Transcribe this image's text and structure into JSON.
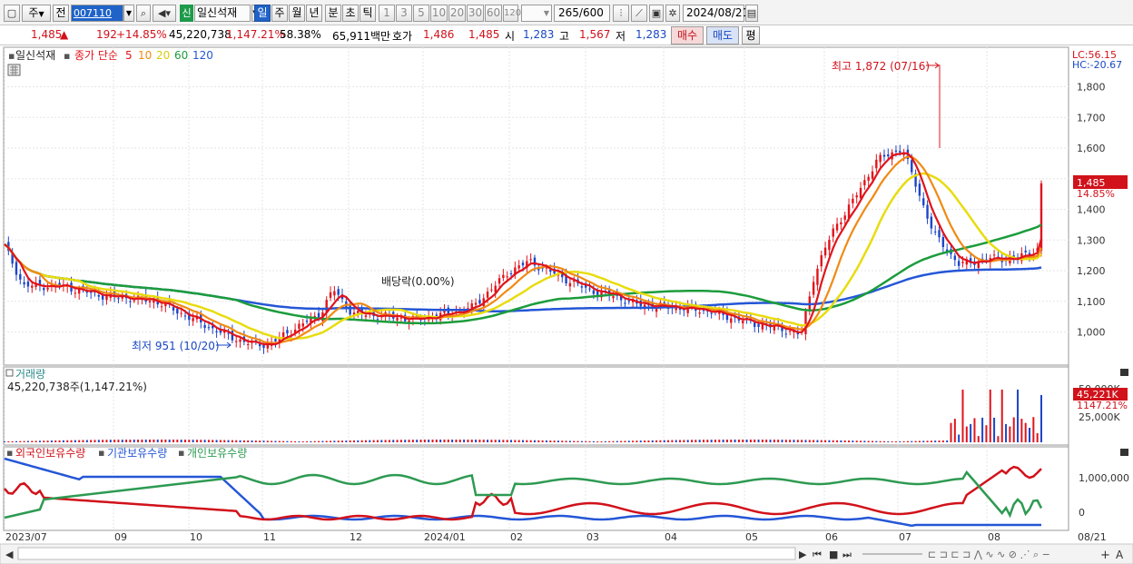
{
  "toolbar": {
    "unit_select": "주",
    "prev_label": "전",
    "stock_code": "007110",
    "badge": "신",
    "stock_name": "일신석재",
    "periods": [
      "일",
      "주",
      "월",
      "년",
      "분",
      "초",
      "틱"
    ],
    "selected_period": "일",
    "intervals": [
      "1",
      "3",
      "5",
      "10",
      "20",
      "30",
      "60",
      "120"
    ],
    "count_display": "265",
    "count_total": "/600",
    "date": "2024/08/21"
  },
  "info": {
    "price": "1,485",
    "change": "192",
    "change_pct": "+14.85%",
    "volume": "45,220,738",
    "volume_ratio": "1,147.21%",
    "turnover_pct": "58.38%",
    "trade_value": "65,911백만",
    "quote_label": "호가",
    "ask": "1,486",
    "bid": "1,485",
    "open_label": "시",
    "open": "1,283",
    "high_label": "고",
    "high": "1,567",
    "low_label": "저",
    "low": "1,283",
    "buy_label": "매수",
    "sell_label": "매도",
    "eval_label": "평"
  },
  "price_panel": {
    "stock_name": "일신석재",
    "ma_label": "종가 단순",
    "ma_periods": [
      {
        "label": "5",
        "color": "#e0141c"
      },
      {
        "label": "10",
        "color": "#f08a14"
      },
      {
        "label": "20",
        "color": "#e8dc10"
      },
      {
        "label": "60",
        "color": "#1c9c3c"
      },
      {
        "label": "120",
        "color": "#2456d6"
      }
    ],
    "lc_label": "LC:56.15",
    "hc_label": "HC:-20.67",
    "high_annotation": "최고 1,872 (07/16)",
    "low_annotation": "최저 951 (10/20)",
    "dividend_annotation": "배당락(0.00%)",
    "current_price_tag": "1,485",
    "current_pct_tag": "14.85%",
    "y_ticks": [
      "1,800",
      "1,700",
      "1,600",
      "1,500",
      "1,400",
      "1,300",
      "1,200",
      "1,100",
      "1,000"
    ]
  },
  "volume_panel": {
    "title": "거래량",
    "value_text": "45,220,738주(1,147.21%)",
    "y_ticks": [
      "50,000K",
      "25,000K"
    ],
    "current_tag": "45,221K",
    "current_pct": "1147.21%"
  },
  "holdings_panel": {
    "series": [
      {
        "name": "외국인보유수량",
        "color": "#d1121b"
      },
      {
        "name": "기관보유수량",
        "color": "#2456d6"
      },
      {
        "name": "개인보유수량",
        "color": "#2e9a52"
      }
    ],
    "y_ticks": [
      "1,000,000",
      "0"
    ]
  },
  "x_axis": {
    "labels": [
      "2023/07",
      "09",
      "10",
      "11",
      "12",
      "2024/01",
      "02",
      "03",
      "04",
      "05",
      "06",
      "07",
      "08",
      "08/21"
    ]
  },
  "colors": {
    "up": "#e0141c",
    "down": "#1d45c8",
    "accent": "#1f63c8"
  },
  "chart_data": {
    "type": "line",
    "x_range": [
      "2023/07",
      "2024/08/21"
    ],
    "price_ylim": [
      950,
      1880
    ],
    "close_prices": [
      {
        "x": "2023/07",
        "y": 1280
      },
      {
        "x": "2023/08",
        "y": 1120
      },
      {
        "x": "2023/09",
        "y": 1110
      },
      {
        "x": "2023/10",
        "y": 1000
      },
      {
        "x": "2023/10/20",
        "y": 951
      },
      {
        "x": "2023/11",
        "y": 1060
      },
      {
        "x": "2023/12",
        "y": 1050
      },
      {
        "x": "2024/01",
        "y": 1220
      },
      {
        "x": "2024/02",
        "y": 1120
      },
      {
        "x": "2024/03",
        "y": 1110
      },
      {
        "x": "2024/04",
        "y": 1080
      },
      {
        "x": "2024/05",
        "y": 1060
      },
      {
        "x": "2024/06",
        "y": 1000
      },
      {
        "x": "2024/07/16",
        "y": 1872
      },
      {
        "x": "2024/08",
        "y": 1250
      },
      {
        "x": "2024/08/21",
        "y": 1485
      }
    ]
  }
}
